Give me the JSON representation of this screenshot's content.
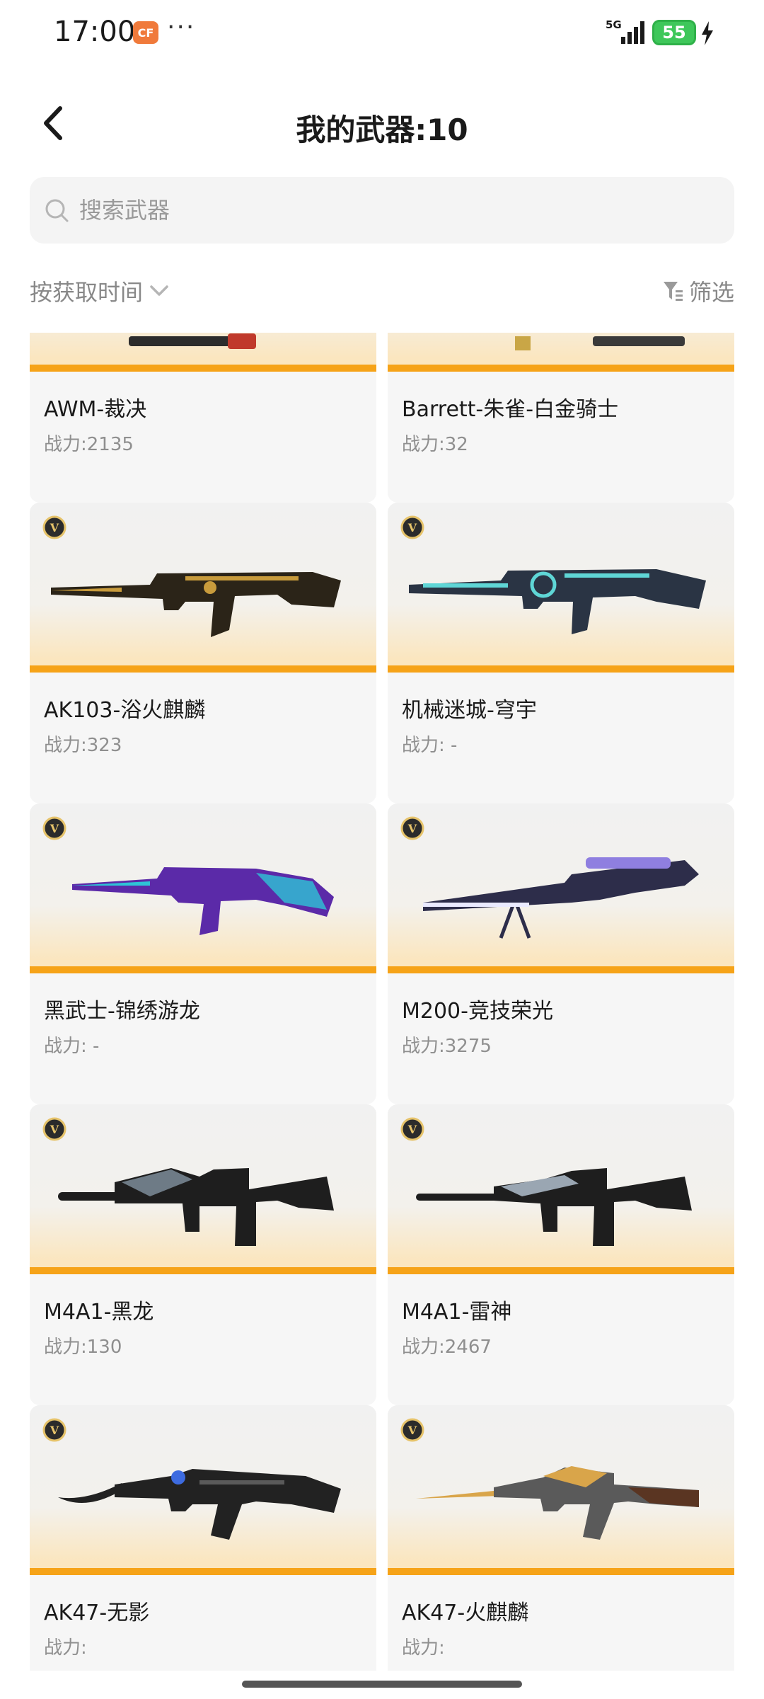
{
  "status_bar": {
    "time": "17:00",
    "app_badge": "CF",
    "dots": "···",
    "network": "5G",
    "battery": "55"
  },
  "header": {
    "title": "我的武器:10"
  },
  "search": {
    "placeholder": "搜索武器",
    "value": ""
  },
  "toolbar": {
    "sort_label": "按获取时间",
    "filter_label": "筛选"
  },
  "weapons": [
    {
      "name": "AWM-裁决",
      "power": "战力:2135",
      "colors": [
        "#2c2c2c",
        "#c0392b"
      ]
    },
    {
      "name": "Barrett-朱雀-白金骑士",
      "power": "战力:32",
      "colors": [
        "#c9a646",
        "#3a3a3a"
      ]
    },
    {
      "name": "AK103-浴火麒麟",
      "power": "战力:323",
      "colors": [
        "#2b2418",
        "#c89b3c"
      ]
    },
    {
      "name": "机械迷城-穹宇",
      "power": "战力: -",
      "colors": [
        "#2a3444",
        "#5fd6d6"
      ]
    },
    {
      "name": "黑武士-锦绣游龙",
      "power": "战力: -",
      "colors": [
        "#5b2aa8",
        "#2ec4d6"
      ]
    },
    {
      "name": "M200-竞技荣光",
      "power": "战力:3275",
      "colors": [
        "#2d2d4a",
        "#8f7fe0"
      ]
    },
    {
      "name": "M4A1-黑龙",
      "power": "战力:130",
      "colors": [
        "#1e1e1e",
        "#6e7b86"
      ]
    },
    {
      "name": "M4A1-雷神",
      "power": "战力:2467",
      "colors": [
        "#1e1e1e",
        "#9aa6b2"
      ]
    },
    {
      "name": "AK47-无影",
      "power": "战力:",
      "colors": [
        "#222222",
        "#3d6be0"
      ]
    },
    {
      "name": "AK47-火麒麟",
      "power": "战力:",
      "colors": [
        "#5a3522",
        "#d9a54a"
      ]
    }
  ]
}
